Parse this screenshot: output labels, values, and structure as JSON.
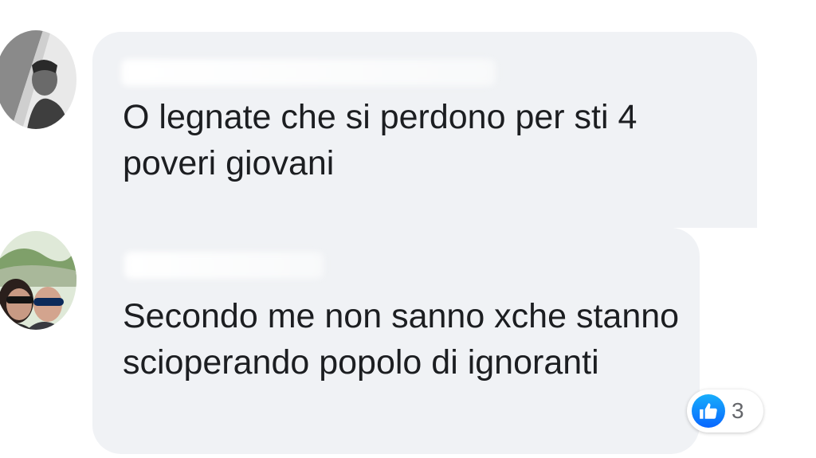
{
  "comments": [
    {
      "author": "",
      "text": "O legnate che si perdono per sti 4 poveri giovani"
    },
    {
      "author": "",
      "text": "Secondo me non sanno xche stanno scioperando popolo di ignoranti",
      "reactions": {
        "icon": "like-icon",
        "count": "3"
      }
    }
  ],
  "colors": {
    "bubble": "#f0f2f5",
    "text": "#1c1e21",
    "like": "#0866ff",
    "count": "#65676b"
  }
}
